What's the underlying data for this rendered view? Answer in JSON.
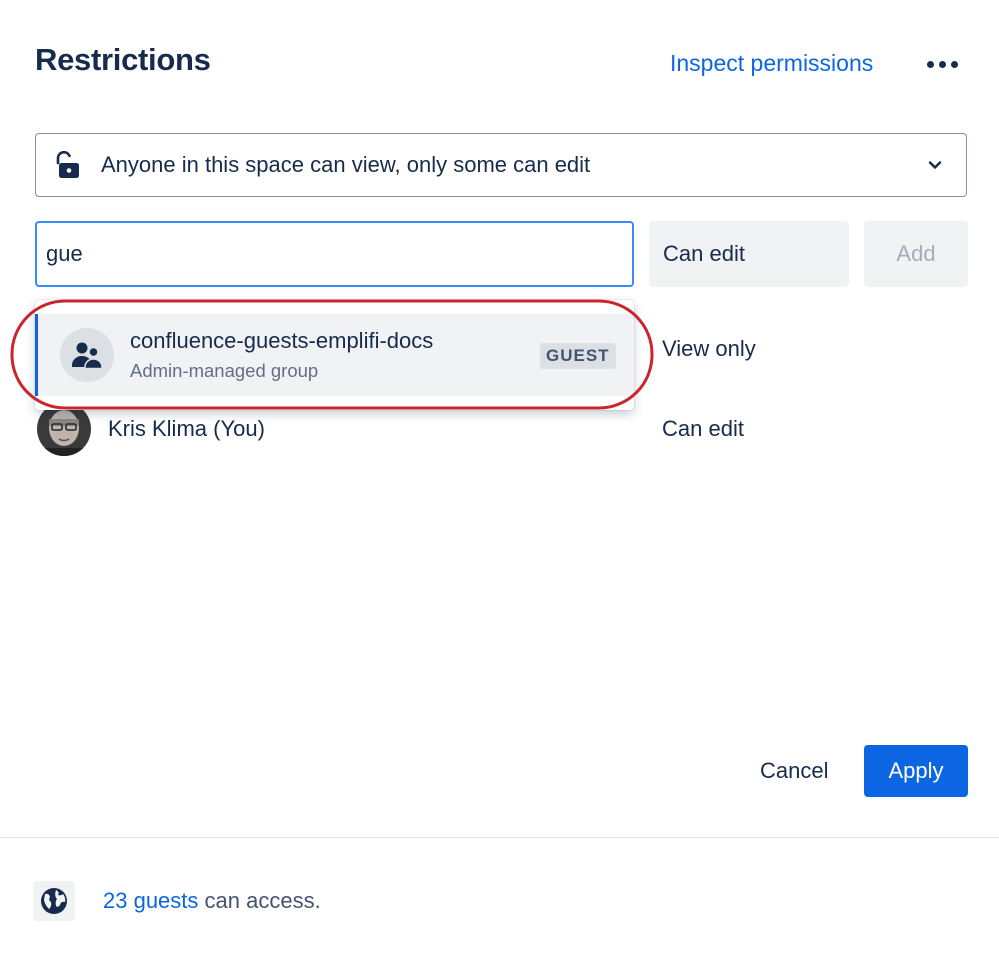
{
  "header": {
    "title": "Restrictions",
    "inspect_link": "Inspect permissions",
    "more_icon": "more-horizontal-icon"
  },
  "restriction_select": {
    "value": "Anyone in this space can view, only some can edit",
    "icon": "unlock-icon"
  },
  "add_form": {
    "search_value": "gue",
    "permission": "Can edit",
    "add_label": "Add"
  },
  "suggestion": {
    "title": "confluence-guests-emplifi-docs",
    "subtitle": "Admin-managed group",
    "badge": "GUEST",
    "icon": "people-group-icon"
  },
  "entries": [
    {
      "name": "",
      "permission": "View only"
    },
    {
      "name": "Kris Klima (You)",
      "permission": "Can edit"
    }
  ],
  "actions": {
    "cancel": "Cancel",
    "apply": "Apply"
  },
  "footer": {
    "link": "23 guests",
    "text": "can access.",
    "icon": "globe-icon"
  },
  "colors": {
    "primary": "#0c66e4",
    "text": "#172b4d",
    "subtle_text": "#626f86",
    "annotation": "#c9252c"
  }
}
